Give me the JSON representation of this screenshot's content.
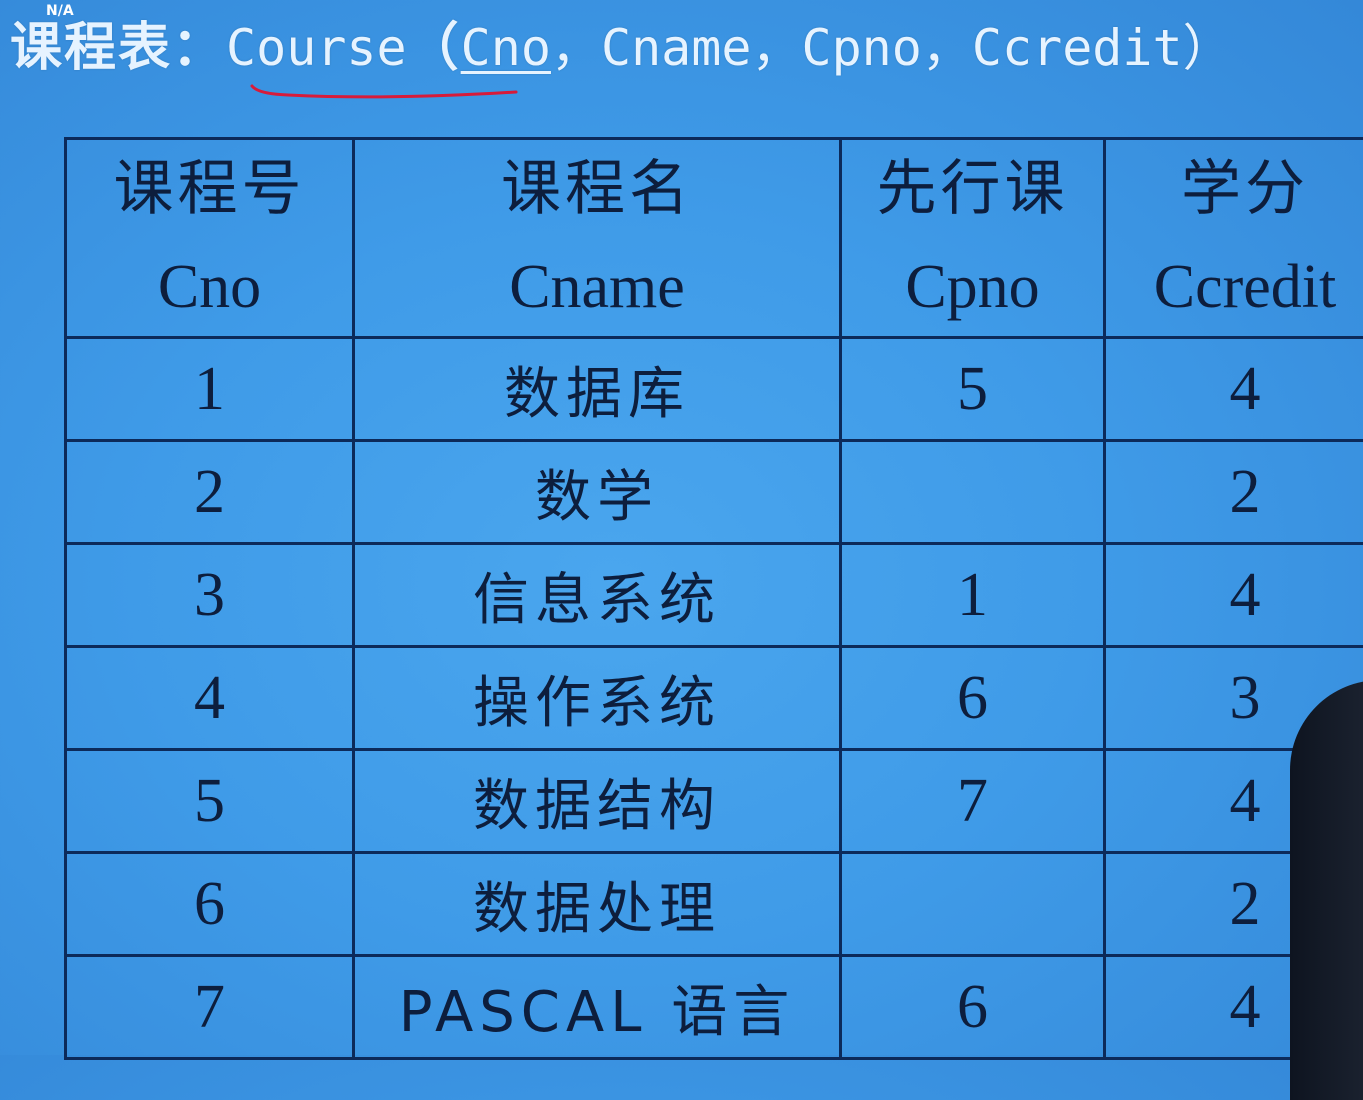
{
  "corner_tag": "N/A",
  "title": {
    "prefix": "课程表：",
    "relation": "Course",
    "open_paren": "（",
    "key_attr": "Cno",
    "rest": "，Cname，Cpno，Ccredit）"
  },
  "table": {
    "headers": [
      {
        "cn": "课程号",
        "en": "Cno"
      },
      {
        "cn": "课程名",
        "en": "Cname"
      },
      {
        "cn": "先行课",
        "en": "Cpno"
      },
      {
        "cn": "学分",
        "en": "Ccredit"
      }
    ],
    "rows": [
      {
        "cno": "1",
        "cname": "数据库",
        "cpno": "5",
        "ccredit": "4"
      },
      {
        "cno": "2",
        "cname": "数学",
        "cpno": "",
        "ccredit": "2"
      },
      {
        "cno": "3",
        "cname": "信息系统",
        "cpno": "1",
        "ccredit": "4"
      },
      {
        "cno": "4",
        "cname": "操作系统",
        "cpno": "6",
        "ccredit": "3"
      },
      {
        "cno": "5",
        "cname": "数据结构",
        "cpno": "7",
        "ccredit": "4"
      },
      {
        "cno": "6",
        "cname": "数据处理",
        "cpno": "",
        "ccredit": "2"
      },
      {
        "cno": "7",
        "cname": "PASCAL 语言",
        "cpno": "6",
        "ccredit": "4"
      }
    ]
  },
  "colors": {
    "background": "#3f9be8",
    "grid_lines": "#0c2a5a",
    "title_text": "#e6f3ff",
    "underline_mark": "#d81b3a"
  }
}
